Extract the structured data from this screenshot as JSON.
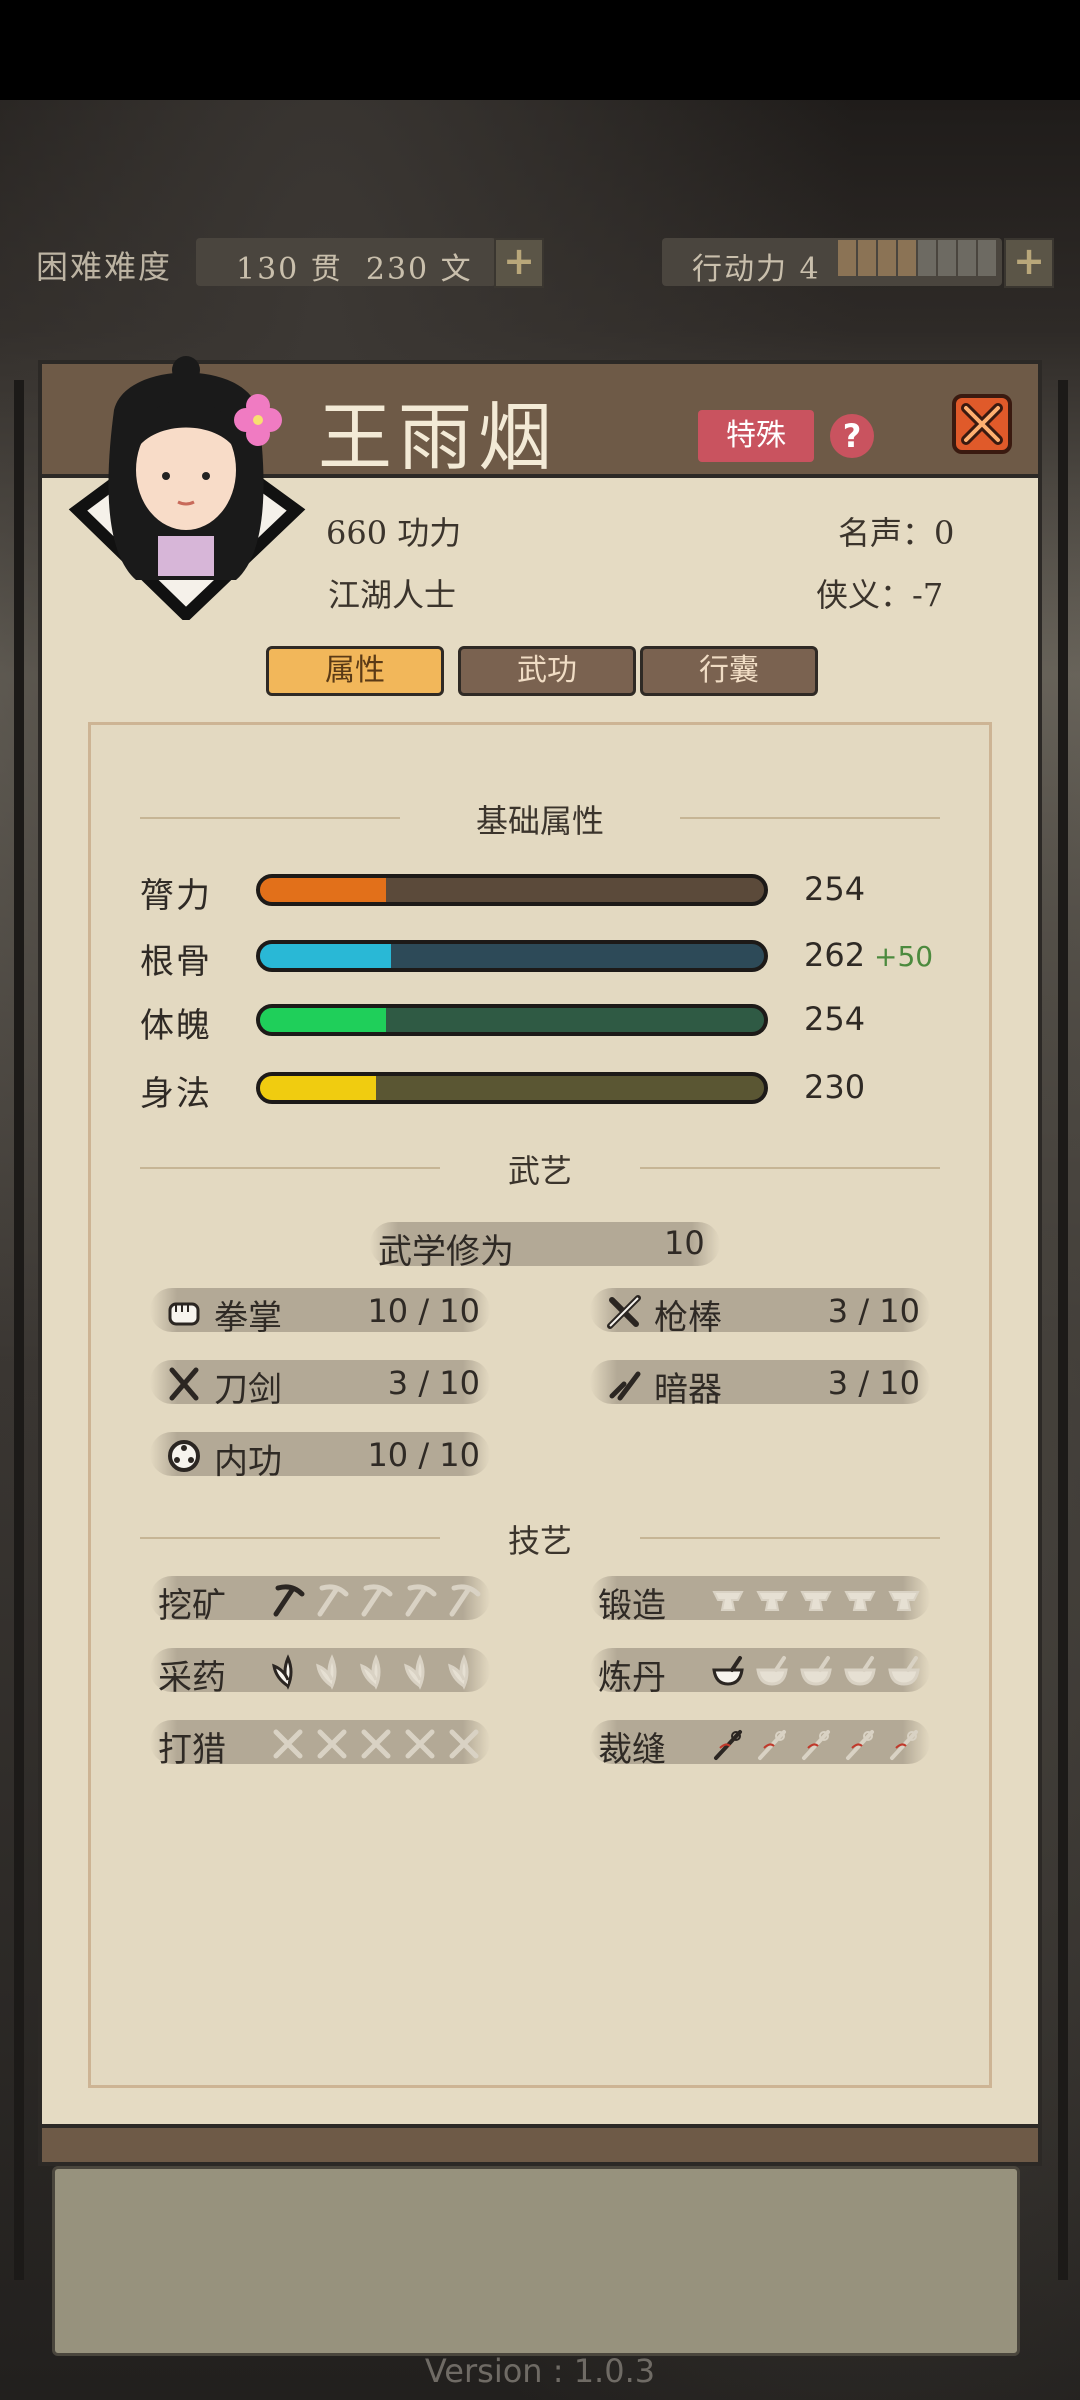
{
  "topbar": {
    "difficulty": "困难难度",
    "money": "130 贯  230 文",
    "action_label": "行动力 4",
    "action_points_total": 8,
    "action_points_filled": 4
  },
  "character": {
    "name": "王雨烟",
    "tag": "特殊",
    "power": "660 功力",
    "identity": "江湖人士",
    "fame": "名声：0",
    "chivalry": "侠义：-7"
  },
  "tabs": [
    {
      "label": "属性",
      "active": true
    },
    {
      "label": "武功",
      "active": false
    },
    {
      "label": "行囊",
      "active": false
    }
  ],
  "sections": {
    "basic": "基础属性",
    "martial": "武艺",
    "craft": "技艺"
  },
  "attributes": [
    {
      "label": "膂力",
      "value": "254",
      "bonus": "",
      "fraction": 0.25,
      "color": "#e2701a",
      "track": "#5b4a3a"
    },
    {
      "label": "根骨",
      "value": "262",
      "bonus": "+50",
      "fraction": 0.26,
      "color": "#29b8d6",
      "track": "#2d4a58"
    },
    {
      "label": "体魄",
      "value": "254",
      "bonus": "",
      "fraction": 0.25,
      "color": "#1fcf5a",
      "track": "#2f5a44"
    },
    {
      "label": "身法",
      "value": "230",
      "bonus": "",
      "fraction": 0.23,
      "color": "#f0cc10",
      "track": "#5a5633"
    }
  ],
  "martial": {
    "total_label": "武学修为",
    "total_value": "10",
    "skills": [
      {
        "name": "拳掌",
        "value": "10 / 10",
        "icon": "fist-icon"
      },
      {
        "name": "枪棒",
        "value": "3 / 10",
        "icon": "spear-icon"
      },
      {
        "name": "刀剑",
        "value": "3 / 10",
        "icon": "sword-icon"
      },
      {
        "name": "暗器",
        "value": "3 / 10",
        "icon": "dart-icon"
      },
      {
        "name": "内功",
        "value": "10 / 10",
        "icon": "inner-icon"
      }
    ]
  },
  "crafts": [
    {
      "name": "挖矿",
      "icon": "pickaxe-icon",
      "level": 1
    },
    {
      "name": "锻造",
      "icon": "anvil-icon",
      "level": 0
    },
    {
      "name": "采药",
      "icon": "herb-icon",
      "level": 1
    },
    {
      "name": "炼丹",
      "icon": "mortar-icon",
      "level": 1
    },
    {
      "name": "打猎",
      "icon": "hunt-icon",
      "level": 0
    },
    {
      "name": "裁缝",
      "icon": "needle-icon",
      "level": 1
    }
  ],
  "version": "Version : 1.0.3"
}
